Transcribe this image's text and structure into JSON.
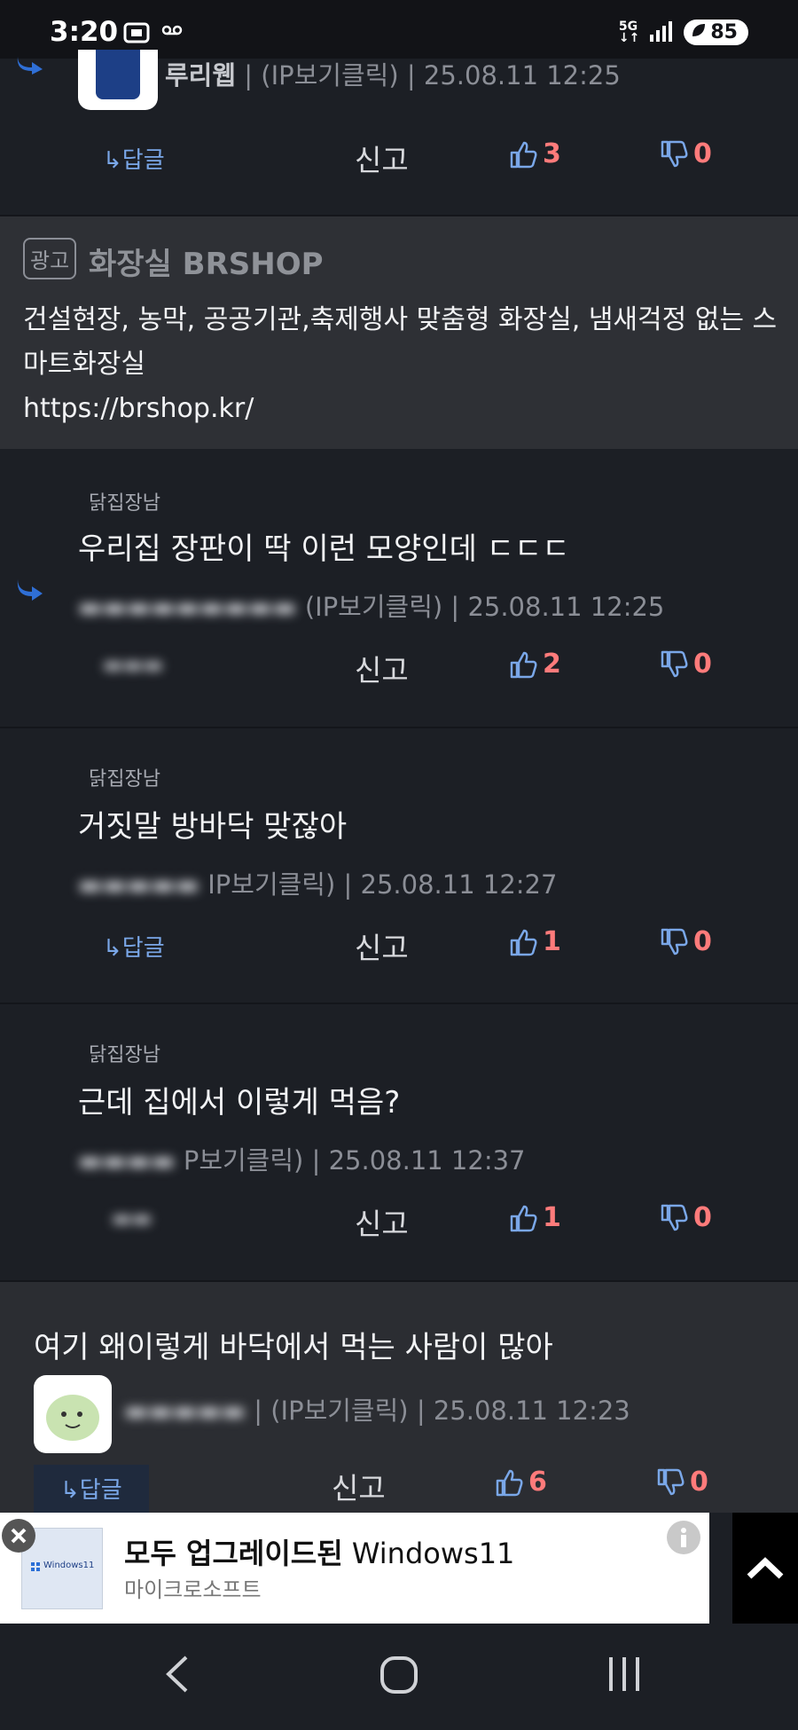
{
  "status_bar": {
    "time": "3:20",
    "network": "5G",
    "battery": "85"
  },
  "comments": [
    {
      "nickname": "",
      "author": "루리웹",
      "ip": "(IP보기클릭)",
      "date": "25.08.11 12:25",
      "reply_label": "↳답글",
      "report_label": "신고",
      "likes": "3",
      "dislikes": "0"
    },
    {
      "nickname": "닭집장남",
      "text": "우리집 장판이 딱 이런 모양인데 ㄷㄷㄷ",
      "ip": "(IP보기클릭)",
      "date": "25.08.11 12:25",
      "report_label": "신고",
      "likes": "2",
      "dislikes": "0"
    },
    {
      "nickname": "닭집장남",
      "text": "거짓말 방바닥 맞잖아",
      "ip": "IP보기클릭)",
      "date": "25.08.11 12:27",
      "reply_label": "↳답글",
      "report_label": "신고",
      "likes": "1",
      "dislikes": "0"
    },
    {
      "nickname": "닭집장남",
      "text": "근데 집에서 이렇게 먹음?",
      "ip": "P보기클릭)",
      "date": "25.08.11 12:37",
      "report_label": "신고",
      "likes": "1",
      "dislikes": "0"
    },
    {
      "text": "여기 왜이렇게  바닥에서 먹는 사람이 많아",
      "ip": "(IP보기클릭)",
      "date": "25.08.11 12:23",
      "reply_label": "↳답글",
      "report_label": "신고",
      "likes": "6",
      "dislikes": "0"
    }
  ],
  "ad": {
    "badge": "광고",
    "title": "화장실 BRSHOP",
    "text": "건설현장, 농막, 공공기관,축제행사 맞춤형 화장실, 냄새걱정 없는 스마트화장실",
    "url": "https://brshop.kr/"
  },
  "banner": {
    "title_bold": "모두 업그레이드된",
    "title_rest": " Windows11",
    "advertiser": "마이크로소프트",
    "thumb_text": "Windows11"
  },
  "colors": {
    "like": "#7aa7e8",
    "count": "#ff7b7b",
    "accent": "#2f6fd6"
  }
}
